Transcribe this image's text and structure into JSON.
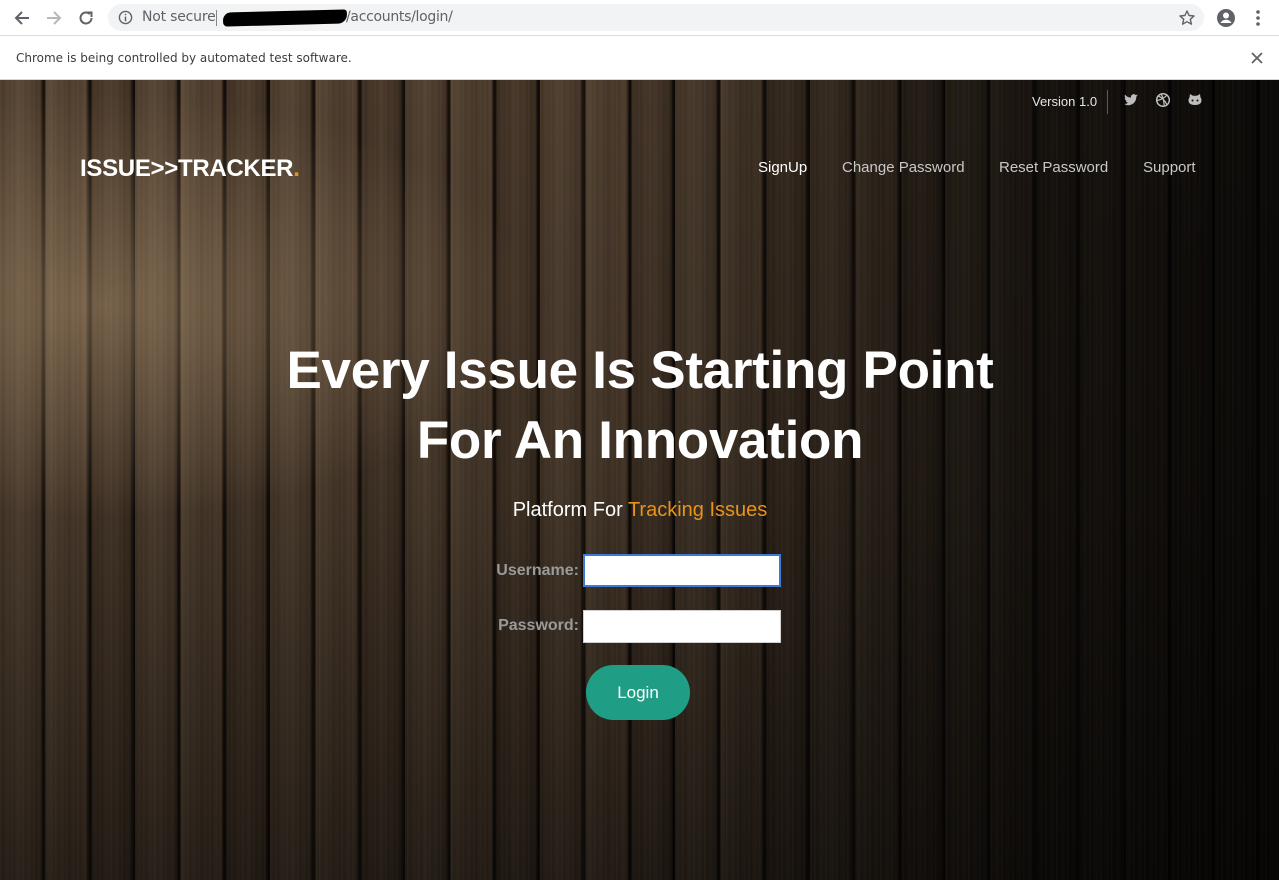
{
  "browser": {
    "security_label": "Not secure",
    "url_visible": "/accounts/login/",
    "infobar_text": "Chrome is being controlled by automated test software."
  },
  "topbar": {
    "version": "Version 1.0",
    "social_icons": [
      "twitter-icon",
      "dribbble-icon",
      "github-icon"
    ]
  },
  "header": {
    "logo_text": "ISSUE>>TRACKER",
    "logo_dot": ".",
    "nav": [
      {
        "label": "SignUp",
        "active": true
      },
      {
        "label": "Change Password",
        "active": false
      },
      {
        "label": "Reset Password",
        "active": false
      },
      {
        "label": "Support",
        "active": false
      }
    ]
  },
  "hero": {
    "line1": "Every Issue Is Starting Point",
    "line2": "For An Innovation",
    "tagline_prefix": "Platform For",
    "tagline_accent": "Tracking Issues"
  },
  "login_form": {
    "username_label": "Username:",
    "username_value": "",
    "password_label": "Password:",
    "password_value": "",
    "submit_label": "Login"
  },
  "colors": {
    "accent_orange": "#e8941a",
    "button_teal": "#1f9e85"
  }
}
